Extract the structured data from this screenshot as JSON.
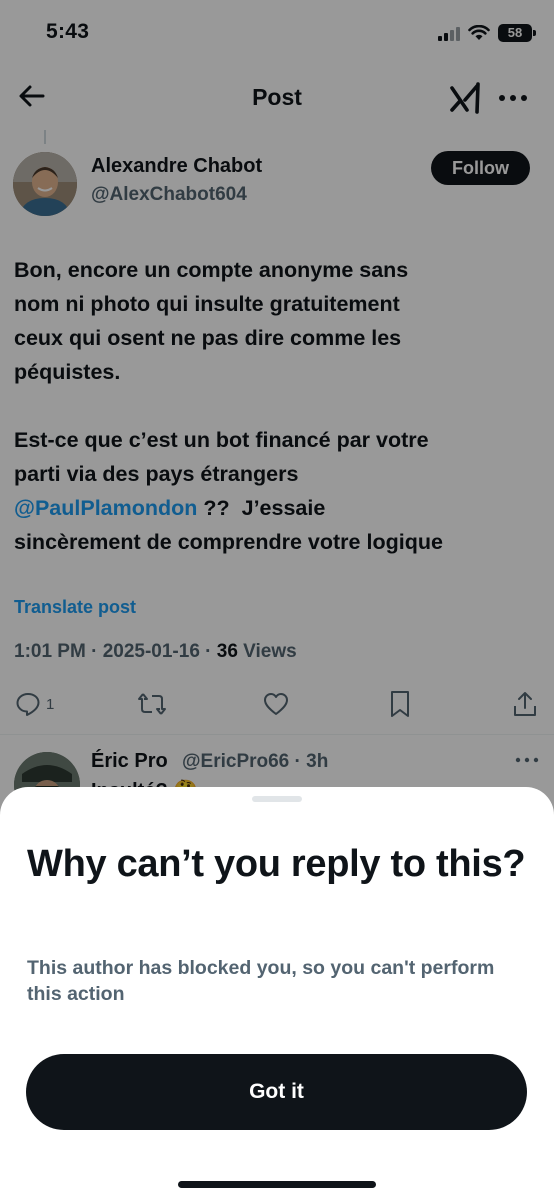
{
  "status_bar": {
    "time": "5:43",
    "battery": "58"
  },
  "header": {
    "title": "Post",
    "back_icon": "arrow-left-icon",
    "grok_icon": "grok-icon",
    "more_icon": "ellipsis-icon"
  },
  "post": {
    "author_name": "Alexandre Chabot",
    "author_handle": "@AlexChabot604",
    "follow_label": "Follow",
    "lines_1": [
      "Bon, encore un compte anonyme sans",
      "nom ni photo qui insulte gratuitement",
      "ceux qui osent ne pas dire comme les",
      "péquistes."
    ],
    "lines_2a": "Est-ce que c’est un bot financé par votre",
    "lines_2b": "parti via des pays étrangers",
    "mention": "@PaulPlamondon",
    "after_mention": " ??  J’essaie",
    "lines_2c": "sincèrement de comprendre votre logique",
    "translate_label": "Translate post",
    "timestamp": "1:01 PM · 2025-01-16 · ",
    "views_count": "36",
    "views_label": " Views",
    "reply_count": "1"
  },
  "reply": {
    "name": "Éric Pro",
    "handle": "@EricPro66 · 3h",
    "peek": "Insulté? 🤔"
  },
  "sheet": {
    "title": "Why can’t you reply to this?",
    "subtitle": "This author has blocked you, so you can't perform this action",
    "button_label": "Got it"
  },
  "colors": {
    "accent": "#1d9bf0",
    "text": "#0f1419",
    "muted": "#536471",
    "button": "#0f1419"
  }
}
